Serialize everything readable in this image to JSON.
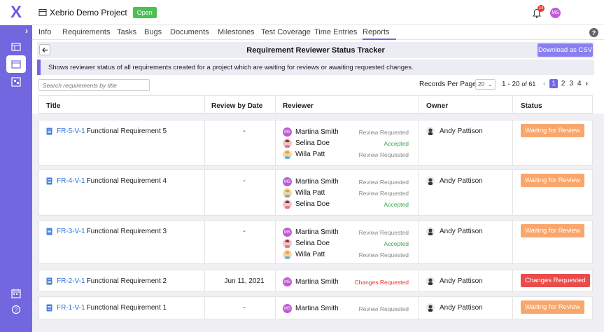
{
  "app": {
    "logo": "X"
  },
  "header": {
    "project_title": "Xebrio Demo Project",
    "project_status": "Open",
    "notification_count": "14",
    "user_initials": "MS"
  },
  "tabs": [
    {
      "label": "Info"
    },
    {
      "label": "Requirements"
    },
    {
      "label": "Tasks"
    },
    {
      "label": "Bugs"
    },
    {
      "label": "Documents"
    },
    {
      "label": "Milestones"
    },
    {
      "label": "Test Coverage"
    },
    {
      "label": "Time Entries"
    },
    {
      "label": "Reports",
      "active": true
    }
  ],
  "page": {
    "title": "Requirement Reviewer Status Tracker",
    "csv_button": "Download as CSV",
    "info": "Shows reviewer status of all requirements created for a project which are waiting for reviews or awaiting requested changes.",
    "search_placeholder": "Search requirements by title",
    "records_per_page_label": "Records Per Page",
    "records_per_page_value": "20",
    "range_text": "1 - 20",
    "range_of": "of 61",
    "pages": [
      "1",
      "2",
      "3",
      "4"
    ],
    "current_page": "1"
  },
  "table": {
    "headers": [
      "Title",
      "Review by Date",
      "Reviewer",
      "Owner",
      "Status"
    ],
    "rows": [
      {
        "id": "FR-5-V-1",
        "title": "Functional Requirement 5",
        "review_by": "-",
        "reviewers": [
          {
            "name": "Martina Smith",
            "status": "Review Requested",
            "avatar": "MS"
          },
          {
            "name": "Selina Doe",
            "status": "Accepted",
            "avatar": ""
          },
          {
            "name": "Willa Patt",
            "status": "Review Requested",
            "avatar": ""
          }
        ],
        "owner": "Andy Pattison",
        "status": "Waiting for Review"
      },
      {
        "id": "FR-4-V-1",
        "title": "Functional Requirement 4",
        "review_by": "-",
        "reviewers": [
          {
            "name": "Martina Smith",
            "status": "Review Requested",
            "avatar": "MS"
          },
          {
            "name": "Willa Patt",
            "status": "Review Requested",
            "avatar": ""
          },
          {
            "name": "Selina Doe",
            "status": "Accepted",
            "avatar": ""
          }
        ],
        "owner": "Andy Pattison",
        "status": "Waiting for Review"
      },
      {
        "id": "FR-3-V-1",
        "title": "Functional Requirement 3",
        "review_by": "-",
        "reviewers": [
          {
            "name": "Martina Smith",
            "status": "Review Requested",
            "avatar": "MS"
          },
          {
            "name": "Selina Doe",
            "status": "Accepted",
            "avatar": ""
          },
          {
            "name": "Willa Patt",
            "status": "Review Requested",
            "avatar": ""
          }
        ],
        "owner": "Andy Pattison",
        "status": "Waiting for Review"
      },
      {
        "id": "FR-2-V-1",
        "title": "Functional Requirement 2",
        "review_by": "Jun 11, 2021",
        "reviewers": [
          {
            "name": "Martina Smith",
            "status": "Changes Requested",
            "avatar": "MS"
          }
        ],
        "owner": "Andy Pattison",
        "status": "Changes Requested"
      },
      {
        "id": "FR-1-V-1",
        "title": "Functional Requirement 1",
        "review_by": "-",
        "reviewers": [
          {
            "name": "Martina Smith",
            "status": "Review Requested",
            "avatar": "MS"
          }
        ],
        "owner": "Andy Pattison",
        "status": "Waiting for Review"
      }
    ]
  },
  "colors": {
    "brand": "#7367e0",
    "link": "#2f6fd6",
    "accepted": "#3aa64a",
    "review_requested": "#888888",
    "changes_requested": "#e53935",
    "waiting_badge": "#f9a66c",
    "changes_badge": "#ea4b4b"
  }
}
